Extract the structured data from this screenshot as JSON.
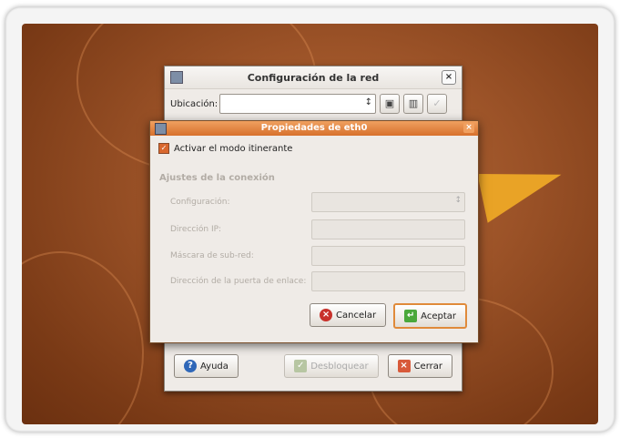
{
  "back_window": {
    "title": "Configuración de la red",
    "close_glyph": "×",
    "location_label": "Ubicación:",
    "location_value": "",
    "combo_arrow": "↕",
    "buttons": {
      "help": "Ayuda",
      "unlock": "Desbloquear",
      "close": "Cerrar"
    }
  },
  "dialog": {
    "title": "Propiedades de eth0",
    "close_glyph": "×",
    "roaming_label": "Activar el modo itinerante",
    "roaming_checked": true,
    "section_title": "Ajustes de la conexión",
    "fields": [
      {
        "label": "Configuración:",
        "value": "",
        "type": "select"
      },
      {
        "label": "Dirección IP:",
        "value": "",
        "type": "text"
      },
      {
        "label": "Máscara de sub-red:",
        "value": "",
        "type": "text"
      },
      {
        "label": "Dirección de la puerta de enlace:",
        "value": "",
        "type": "text"
      }
    ],
    "cancel_label": "Cancelar",
    "accept_label": "Aceptar"
  },
  "colors": {
    "desktop": "#9c5328",
    "dialog_title": "#d7702c",
    "accent": "#e08a3a"
  }
}
